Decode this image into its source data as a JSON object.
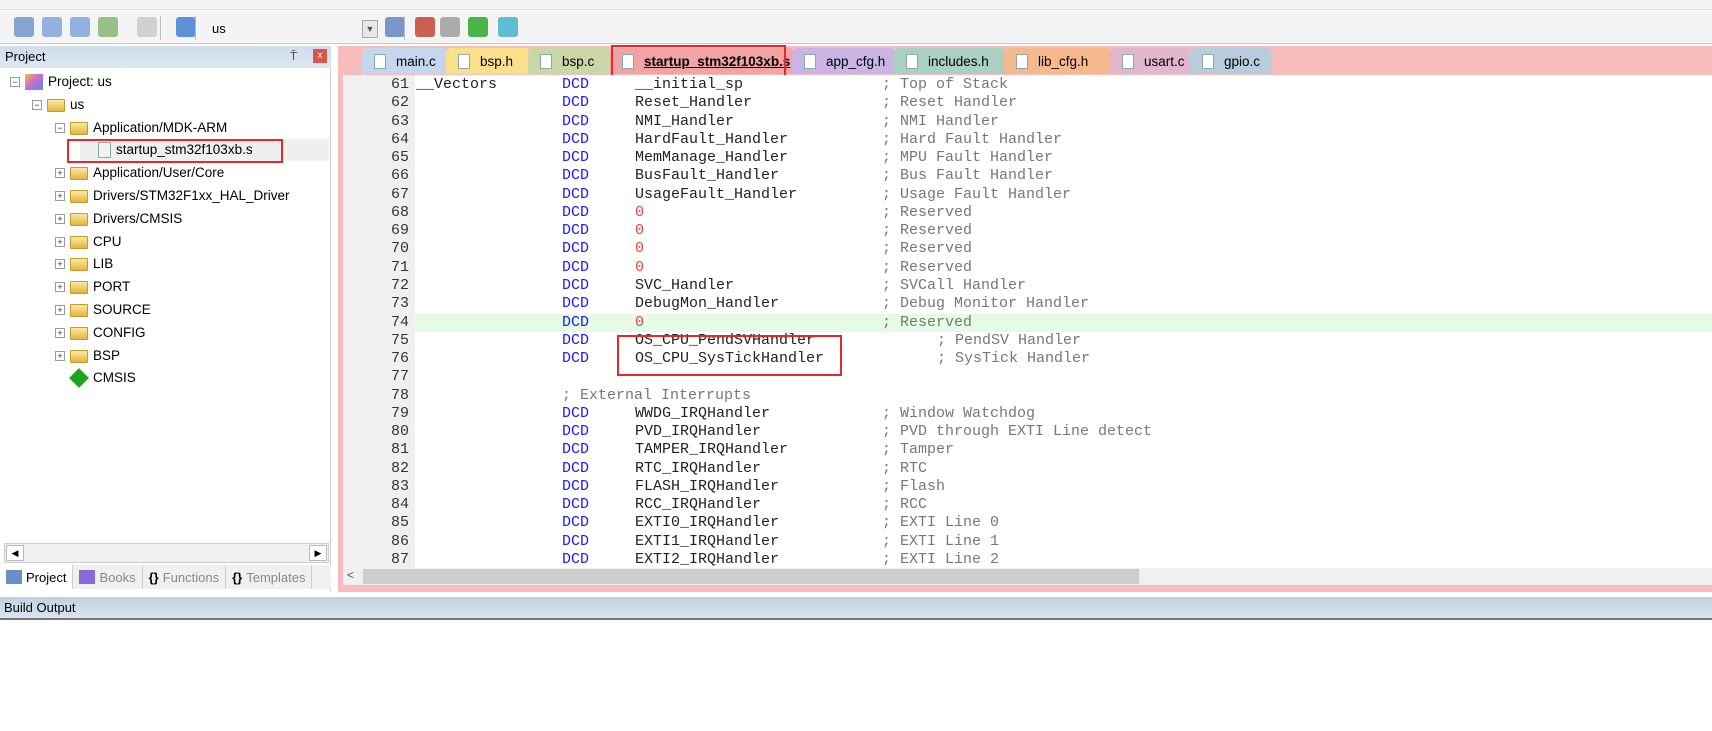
{
  "toolbar": {
    "target": "us",
    "icons": [
      "batch-build-icon",
      "translate-icon",
      "build-icon",
      "rebuild-icon",
      "stop-build-icon",
      "download-icon",
      "target-options-icon",
      "manage-components-icon",
      "environment-icon",
      "select-packs-icon",
      "pack-installer-icon"
    ]
  },
  "project_panel": {
    "title": "Project",
    "pin": "⍑",
    "close": "x",
    "tree": [
      {
        "label": "Project: us",
        "level": 0,
        "expander": "-",
        "icon": "project-icon"
      },
      {
        "label": "us",
        "level": 1,
        "expander": "-",
        "icon": "target-folder-icon"
      },
      {
        "label": "Application/MDK-ARM",
        "level": 2,
        "expander": "-",
        "icon": "folder-open-icon"
      },
      {
        "label": "startup_stm32f103xb.s",
        "level": 3,
        "expander": "",
        "icon": "file-icon",
        "selected": true
      },
      {
        "label": "Application/User/Core",
        "level": 2,
        "expander": "+",
        "icon": "folder-icon"
      },
      {
        "label": "Drivers/STM32F1xx_HAL_Driver",
        "level": 2,
        "expander": "+",
        "icon": "folder-icon"
      },
      {
        "label": "Drivers/CMSIS",
        "level": 2,
        "expander": "+",
        "icon": "folder-icon"
      },
      {
        "label": "CPU",
        "level": 2,
        "expander": "+",
        "icon": "folder-icon"
      },
      {
        "label": "LIB",
        "level": 2,
        "expander": "+",
        "icon": "folder-icon"
      },
      {
        "label": "PORT",
        "level": 2,
        "expander": "+",
        "icon": "folder-icon"
      },
      {
        "label": "SOURCE",
        "level": 2,
        "expander": "+",
        "icon": "folder-icon"
      },
      {
        "label": "CONFIG",
        "level": 2,
        "expander": "+",
        "icon": "folder-icon"
      },
      {
        "label": "BSP",
        "level": 2,
        "expander": "+",
        "icon": "folder-icon"
      },
      {
        "label": "CMSIS",
        "level": 2,
        "expander": "",
        "icon": "component-icon"
      }
    ],
    "bottom_tabs": [
      {
        "label": "Project",
        "active": true
      },
      {
        "label": "Books"
      },
      {
        "label": "Functions"
      },
      {
        "label": "Templates"
      }
    ]
  },
  "editor": {
    "tabs": [
      {
        "label": "main.c",
        "color": "#c6d6ee"
      },
      {
        "label": "bsp.h",
        "color": "#fbe08c"
      },
      {
        "label": "bsp.c",
        "color": "#cbd6a8"
      },
      {
        "label": "startup_stm32f103xb.s",
        "color": "#f2a3a3",
        "active": true
      },
      {
        "label": "app_cfg.h",
        "color": "#c9b4e4"
      },
      {
        "label": "includes.h",
        "color": "#a9d0c0"
      },
      {
        "label": "lib_cfg.h",
        "color": "#f6b98c"
      },
      {
        "label": "usart.c",
        "color": "#e0b7cd"
      },
      {
        "label": "gpio.c",
        "color": "#b7cddd"
      }
    ],
    "current_line": 74,
    "lines": [
      {
        "n": "61",
        "label": "__Vectors",
        "op": "DCD",
        "arg": "__initial_sp",
        "comment": "; Top of Stack"
      },
      {
        "n": "62",
        "op": "DCD",
        "arg": "Reset_Handler",
        "comment": "; Reset Handler"
      },
      {
        "n": "63",
        "op": "DCD",
        "arg": "NMI_Handler",
        "comment": "; NMI Handler"
      },
      {
        "n": "64",
        "op": "DCD",
        "arg": "HardFault_Handler",
        "comment": "; Hard Fault Handler"
      },
      {
        "n": "65",
        "op": "DCD",
        "arg": "MemManage_Handler",
        "comment": "; MPU Fault Handler"
      },
      {
        "n": "66",
        "op": "DCD",
        "arg": "BusFault_Handler",
        "comment": "; Bus Fault Handler"
      },
      {
        "n": "67",
        "op": "DCD",
        "arg": "UsageFault_Handler",
        "comment": "; Usage Fault Handler"
      },
      {
        "n": "68",
        "op": "DCD",
        "arg": "0",
        "comment": "; Reserved",
        "num": true
      },
      {
        "n": "69",
        "op": "DCD",
        "arg": "0",
        "comment": "; Reserved",
        "num": true
      },
      {
        "n": "70",
        "op": "DCD",
        "arg": "0",
        "comment": "; Reserved",
        "num": true
      },
      {
        "n": "71",
        "op": "DCD",
        "arg": "0",
        "comment": "; Reserved",
        "num": true
      },
      {
        "n": "72",
        "op": "DCD",
        "arg": "SVC_Handler",
        "comment": "; SVCall Handler"
      },
      {
        "n": "73",
        "op": "DCD",
        "arg": "DebugMon_Handler",
        "comment": "; Debug Monitor Handler"
      },
      {
        "n": "74",
        "op": "DCD",
        "arg": "0",
        "comment": "; Reserved",
        "num": true
      },
      {
        "n": "75",
        "op": "DCD",
        "arg": "OS_CPU_PendSVHandler",
        "comment": "; PendSV Handler",
        "far": true
      },
      {
        "n": "76",
        "op": "DCD",
        "arg": "OS_CPU_SysTickHandler",
        "comment": "; SysTick Handler",
        "far": true
      },
      {
        "n": "77"
      },
      {
        "n": "78",
        "op": "; External Interrupts",
        "opcomment": true
      },
      {
        "n": "79",
        "op": "DCD",
        "arg": "WWDG_IRQHandler",
        "comment": "; Window Watchdog"
      },
      {
        "n": "80",
        "op": "DCD",
        "arg": "PVD_IRQHandler",
        "comment": "; PVD through EXTI Line detect"
      },
      {
        "n": "81",
        "op": "DCD",
        "arg": "TAMPER_IRQHandler",
        "comment": "; Tamper"
      },
      {
        "n": "82",
        "op": "DCD",
        "arg": "RTC_IRQHandler",
        "comment": "; RTC"
      },
      {
        "n": "83",
        "op": "DCD",
        "arg": "FLASH_IRQHandler",
        "comment": "; Flash"
      },
      {
        "n": "84",
        "op": "DCD",
        "arg": "RCC_IRQHandler",
        "comment": "; RCC"
      },
      {
        "n": "85",
        "op": "DCD",
        "arg": "EXTI0_IRQHandler",
        "comment": "; EXTI Line 0"
      },
      {
        "n": "86",
        "op": "DCD",
        "arg": "EXTI1_IRQHandler",
        "comment": "; EXTI Line 1"
      },
      {
        "n": "87",
        "op": "DCD",
        "arg": "EXTI2_IRQHandler",
        "comment": "; EXTI Line 2"
      }
    ]
  },
  "build_output": {
    "title": "Build Output"
  },
  "colors": {
    "highlight_box": "#e8262d",
    "keyword": "#1a1aff",
    "number": "#e8453c",
    "comment": "#777777",
    "current_line": "#e6fbe6"
  }
}
